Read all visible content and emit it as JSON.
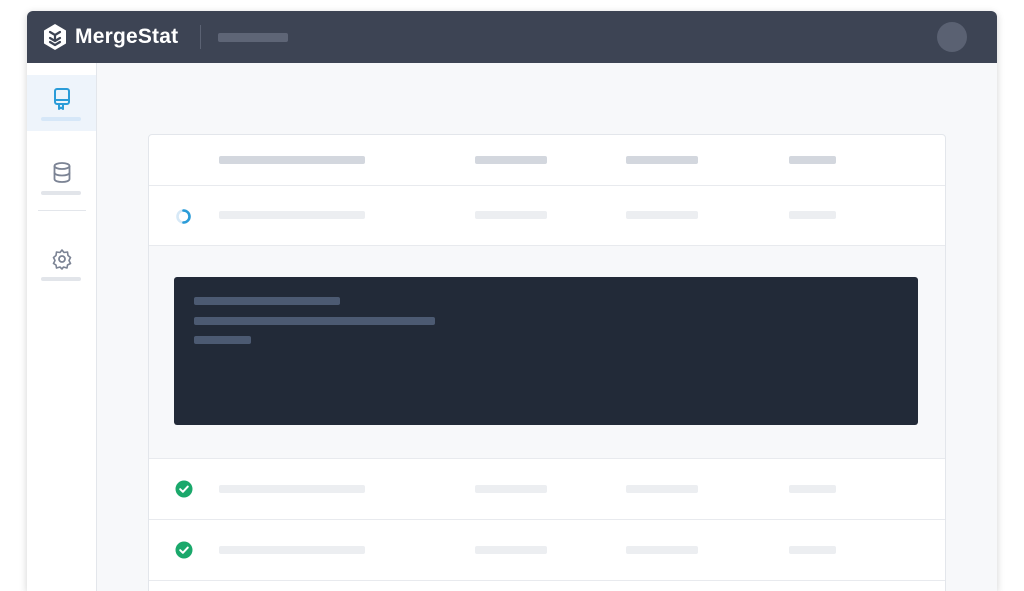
{
  "app": {
    "brand": "MergeStat",
    "logo_icon": "mergestat-logo-icon",
    "avatar_icon": "user-avatar"
  },
  "sidebar": {
    "items": [
      {
        "icon": "repository-icon",
        "active": true
      },
      {
        "icon": "database-icon",
        "active": false
      },
      {
        "icon": "gear-icon",
        "active": false
      }
    ]
  },
  "colors": {
    "topbar": "#3d4454",
    "accent": "#2b9cd8",
    "success": "#1aa86b",
    "console_bg": "#222a38"
  },
  "table": {
    "rows": [
      {
        "status": "loading-spinner-icon"
      },
      {
        "status": "check-circle-icon"
      },
      {
        "status": "check-circle-icon"
      }
    ]
  }
}
